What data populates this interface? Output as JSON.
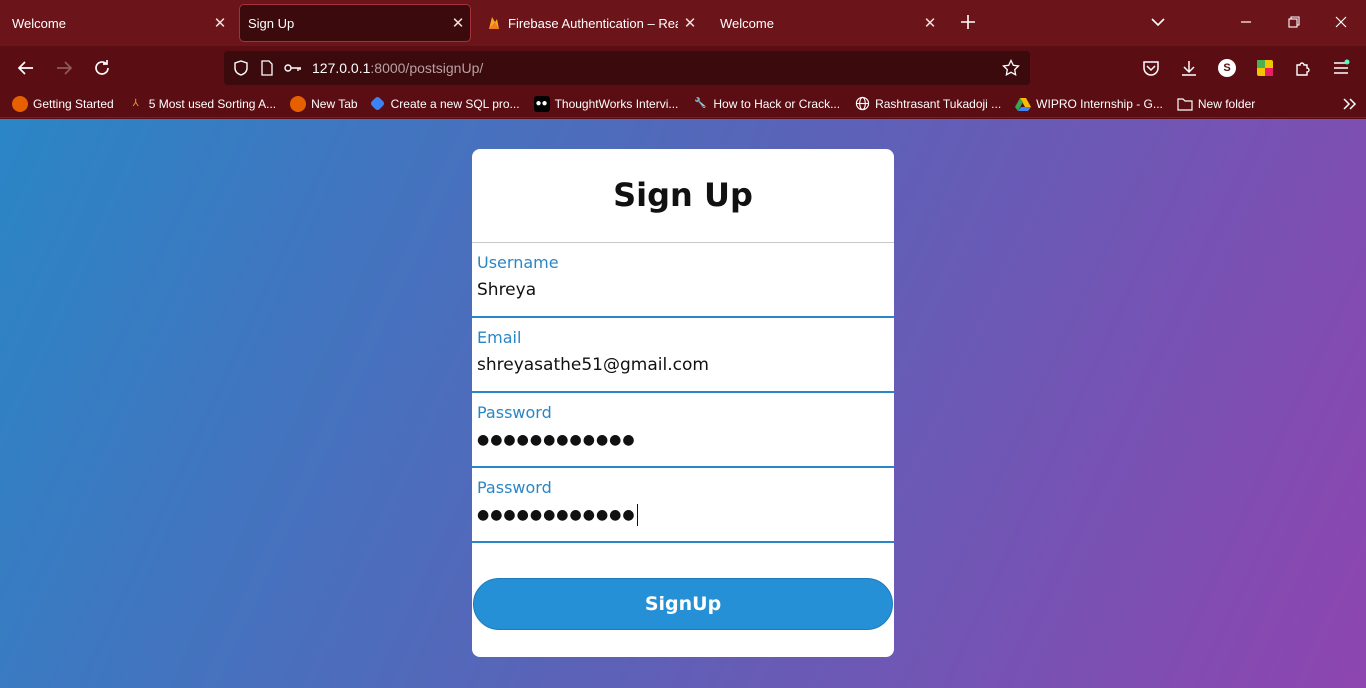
{
  "tabs": [
    {
      "title": "Welcome",
      "active": false
    },
    {
      "title": "Sign Up",
      "active": true
    },
    {
      "title": "Firebase Authentication – Realtim",
      "active": false
    },
    {
      "title": "Welcome",
      "active": false
    }
  ],
  "address": {
    "host": "127.0.0.1",
    "path": ":8000/postsignUp/"
  },
  "profile_initial": "S",
  "bookmarks": [
    {
      "label": "Getting Started",
      "icon": "firefox-icon"
    },
    {
      "label": "5 Most used Sorting A...",
      "icon": "bookmark-icon"
    },
    {
      "label": "New Tab",
      "icon": "firefox-icon"
    },
    {
      "label": "Create a new SQL pro...",
      "icon": "bookmark-icon"
    },
    {
      "label": "ThoughtWorks Intervi...",
      "icon": "medium-icon"
    },
    {
      "label": "How to Hack or Crack...",
      "icon": "wrench-icon"
    },
    {
      "label": "Rashtrasant Tukadoji ...",
      "icon": "globe-icon"
    },
    {
      "label": "WIPRO Internship - G...",
      "icon": "drive-icon"
    },
    {
      "label": "New folder",
      "icon": "folder-icon"
    }
  ],
  "form": {
    "title": "Sign Up",
    "username_label": "Username",
    "username_value": "Shreya",
    "email_label": "Email",
    "email_value": "shreyasathe51@gmail.com",
    "password_label": "Password",
    "password_value": "●●●●●●●●●●●●",
    "confirm_label": "Password",
    "confirm_value": "●●●●●●●●●●●●",
    "submit_label": "SignUp"
  },
  "colors": {
    "accent": "#2690d6",
    "chrome": "#5a0d12"
  }
}
